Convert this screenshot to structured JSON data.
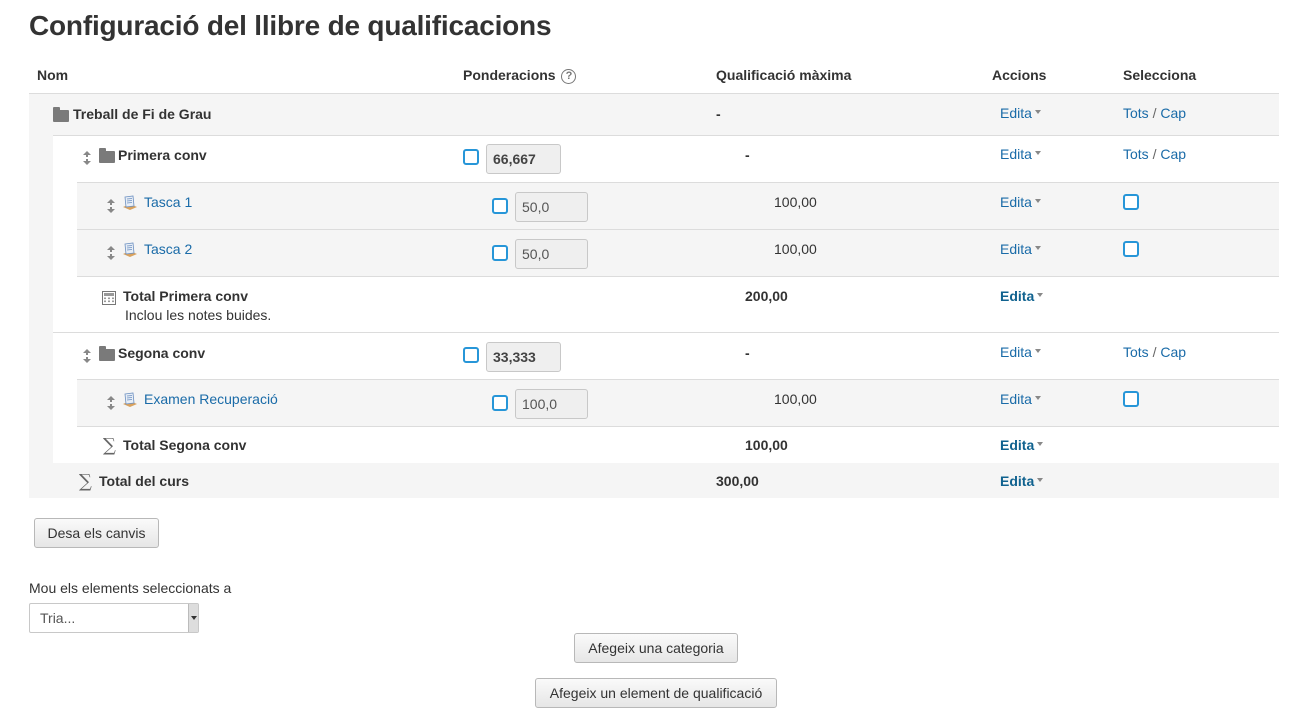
{
  "page": {
    "title": "Configuració del llibre de qualificacions"
  },
  "columns": {
    "name": "Nom",
    "weights": "Ponderacions",
    "max_grade": "Qualificació màxima",
    "actions": "Accions",
    "select": "Selecciona"
  },
  "common": {
    "edit": "Edita",
    "all": "Tots",
    "none": "Cap",
    "sep": "/"
  },
  "rows": {
    "course": {
      "name": "Treball de Fi de Grau",
      "max": "-"
    },
    "cat1": {
      "name": "Primera conv",
      "weight": "66,667",
      "max": "-"
    },
    "item1": {
      "name": "Tasca 1",
      "weight": "50,0",
      "max": "100,00"
    },
    "item2": {
      "name": "Tasca 2",
      "weight": "50,0",
      "max": "100,00"
    },
    "total1": {
      "name": "Total Primera conv",
      "note": "Inclou les notes buides.",
      "max": "200,00"
    },
    "cat2": {
      "name": "Segona conv",
      "weight": "33,333",
      "max": "-"
    },
    "item3": {
      "name": "Examen Recuperació",
      "weight": "100,0",
      "max": "100,00"
    },
    "total2": {
      "name": "Total Segona conv",
      "max": "100,00"
    },
    "course_total": {
      "name": "Total del curs",
      "max": "300,00"
    }
  },
  "buttons": {
    "save": "Desa els canvis",
    "add_category": "Afegeix una categoria",
    "add_item": "Afegeix un element de qualificació"
  },
  "move": {
    "label": "Mou els elements seleccionats a",
    "selected": "Tria..."
  },
  "icons": [
    "help-icon",
    "folder-icon",
    "move-icon",
    "assignment-icon",
    "calculator-icon",
    "sigma-icon",
    "caret-down-icon"
  ]
}
